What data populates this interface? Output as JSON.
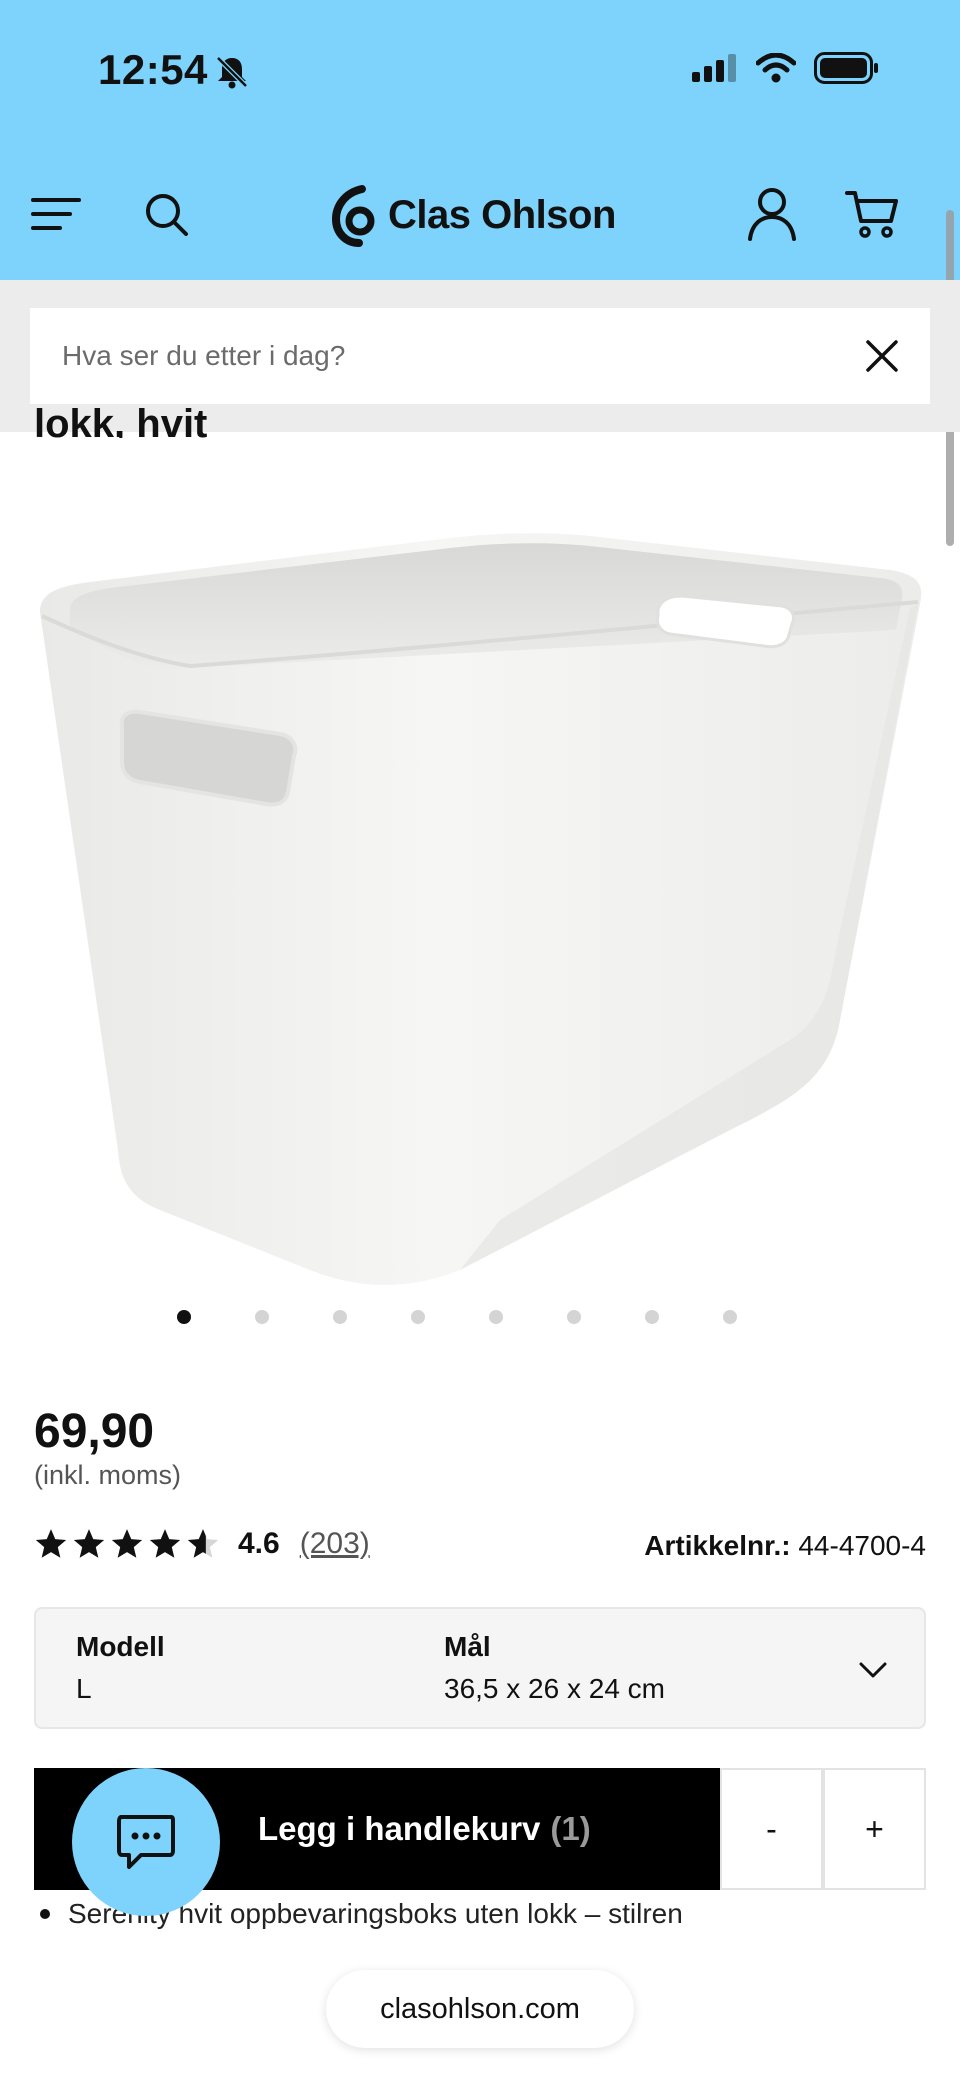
{
  "status_bar": {
    "time": "12:54"
  },
  "header": {
    "brand_name": "Clas Ohlson",
    "brand_color": "#7dd3fb",
    "icons": [
      "menu-icon",
      "search-icon",
      "account-icon",
      "cart-icon"
    ]
  },
  "search": {
    "placeholder": "Hva ser du etter i dag?",
    "value": ""
  },
  "product": {
    "title_fragment": "lokk, hvit",
    "image_alt": "",
    "price": "69,90",
    "price_note": "(inkl. moms)",
    "rating_value": "4.6",
    "rating_stars": 4.6,
    "review_count": "(203)",
    "sku_label": "Artikkelnr.:",
    "sku_value": "44-4700-4"
  },
  "gallery": {
    "total": 8,
    "active_index": 0
  },
  "variant": {
    "model_label": "Modell",
    "model_value": "L",
    "size_label": "Mål",
    "size_value": "36,5 x 26 x 24 cm"
  },
  "cart": {
    "add_label": "Legg i handlekurv",
    "quantity_display": "(1)",
    "minus_label": "-",
    "plus_label": "+"
  },
  "description": {
    "bullet_1": "Serenity hvit oppbevaringsboks uten lokk – stilren"
  },
  "browser": {
    "url": "clasohlson.com"
  }
}
